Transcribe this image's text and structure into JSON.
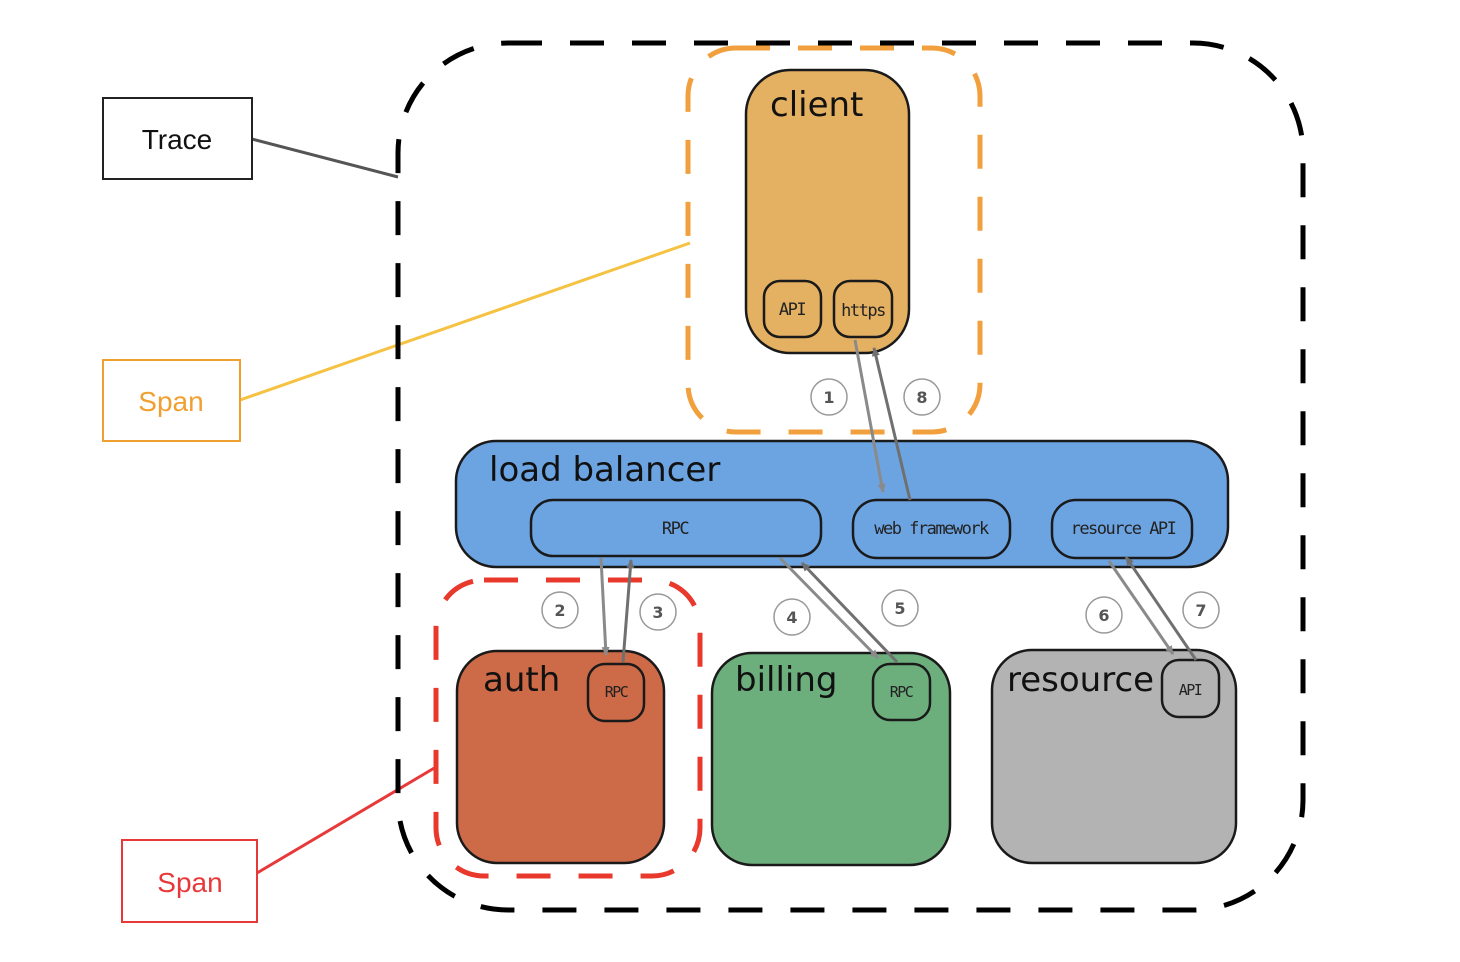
{
  "diagram": {
    "legend": {
      "trace": {
        "label": "Trace",
        "color": "#000000",
        "line_color": "#555555"
      },
      "span_client": {
        "label": "Span",
        "color": "#f0a030",
        "line_color": "#f5c242"
      },
      "span_auth": {
        "label": "Span",
        "color": "#e8393a",
        "line_color": "#e8393a"
      }
    },
    "trace_boundary": {
      "color": "#000000"
    },
    "span_boundaries": {
      "client": {
        "color": "#f2a03d"
      },
      "auth": {
        "color": "#e8392c"
      }
    },
    "nodes": {
      "client": {
        "title": "client",
        "fill": "#e4b062",
        "components": [
          {
            "label": "API"
          },
          {
            "label": "https"
          }
        ]
      },
      "load_balancer": {
        "title": "load balancer",
        "fill": "#6ca4e2",
        "components": [
          {
            "label": "RPC"
          },
          {
            "label": "web framework"
          },
          {
            "label": "resource API"
          }
        ]
      },
      "auth": {
        "title": "auth",
        "fill": "#cd6a47",
        "components": [
          {
            "label": "RPC"
          }
        ]
      },
      "billing": {
        "title": "billing",
        "fill": "#6caf7c",
        "components": [
          {
            "label": "RPC"
          }
        ]
      },
      "resource": {
        "title": "resource",
        "fill": "#b3b3b3",
        "components": [
          {
            "label": "API"
          }
        ]
      }
    },
    "steps": [
      {
        "number": "1",
        "from": "client.https",
        "to": "load_balancer.web framework"
      },
      {
        "number": "2",
        "from": "load_balancer.RPC",
        "to": "auth.RPC"
      },
      {
        "number": "3",
        "from": "auth.RPC",
        "to": "load_balancer.RPC"
      },
      {
        "number": "4",
        "from": "load_balancer.RPC",
        "to": "billing.RPC"
      },
      {
        "number": "5",
        "from": "billing.RPC",
        "to": "load_balancer.RPC"
      },
      {
        "number": "6",
        "from": "load_balancer.resource API",
        "to": "resource.API"
      },
      {
        "number": "7",
        "from": "resource.API",
        "to": "load_balancer.resource API"
      },
      {
        "number": "8",
        "from": "load_balancer.web framework",
        "to": "client.https"
      }
    ],
    "arrow_color": "#8a8a8a"
  }
}
